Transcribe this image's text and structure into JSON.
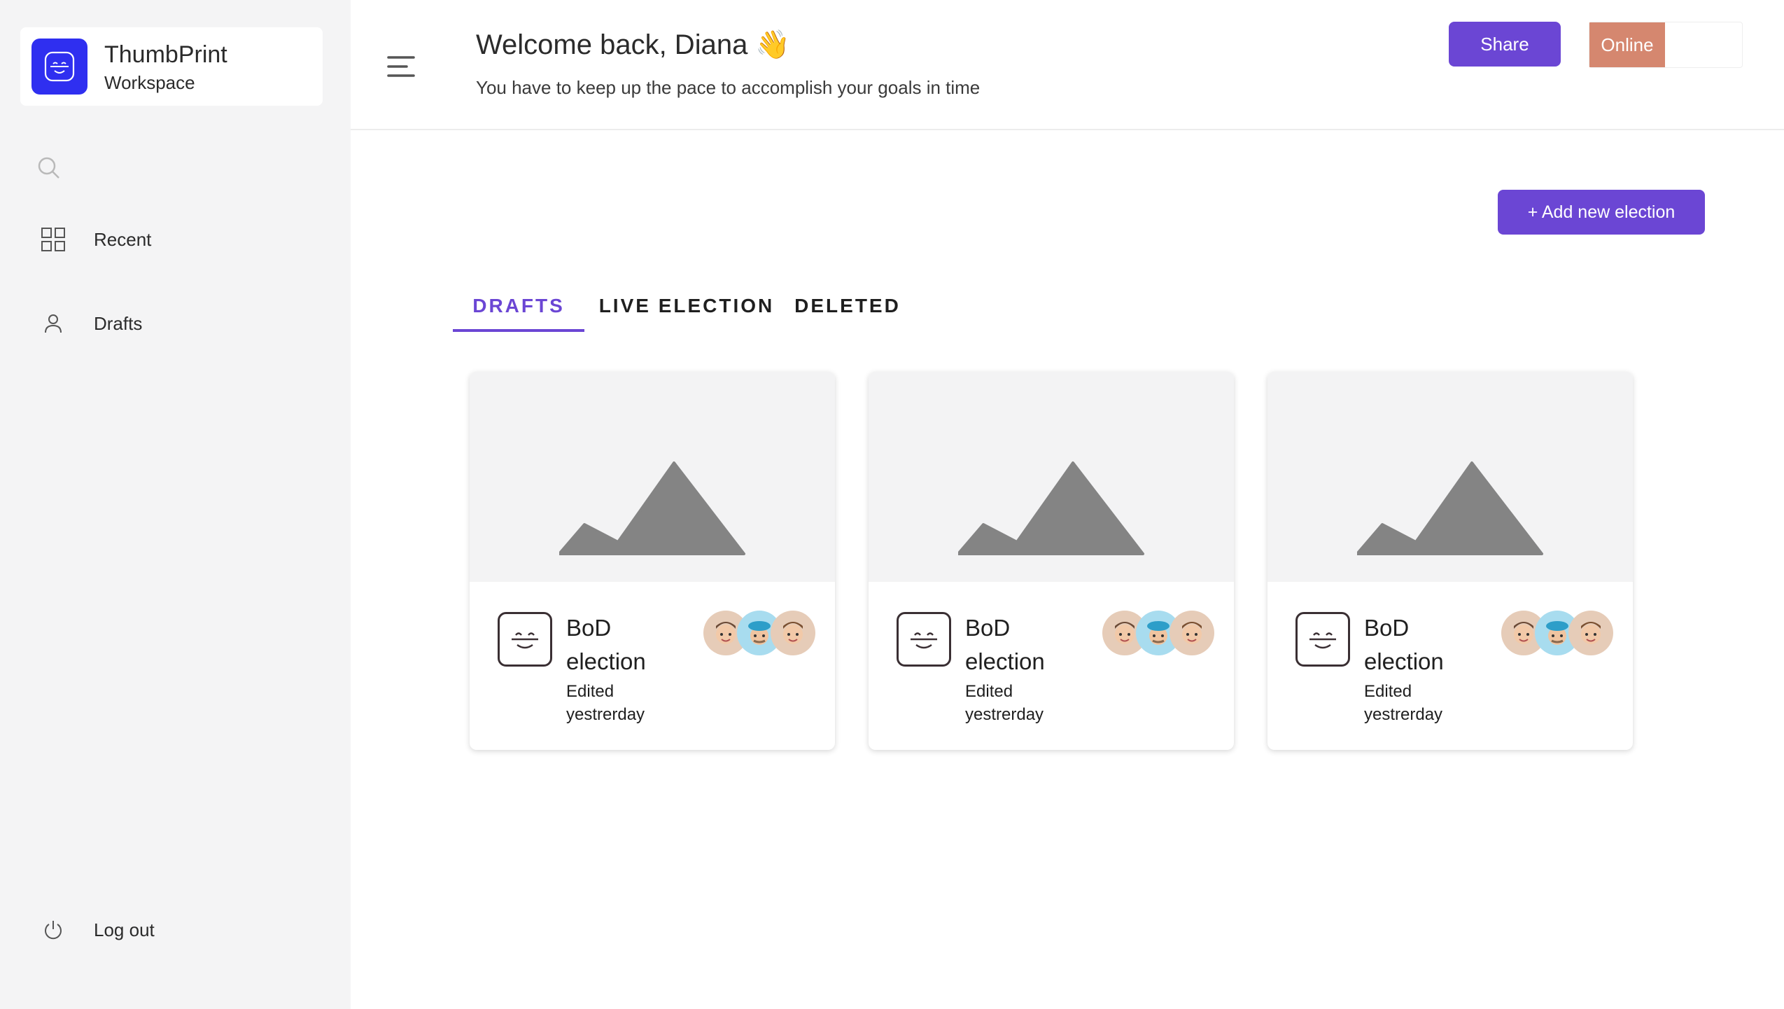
{
  "brand": {
    "name": "ThumbPrint",
    "subtitle": "Workspace",
    "icon": "face-scan-icon",
    "color": "#2f2ff0"
  },
  "sidebar": {
    "search_icon": "search-icon",
    "items": [
      {
        "label": "Recent",
        "icon": "grid-icon"
      },
      {
        "label": "Drafts",
        "icon": "user-icon"
      }
    ],
    "logout": {
      "label": "Log out",
      "icon": "power-icon"
    }
  },
  "header": {
    "menu_icon": "menu-icon",
    "welcome": "Welcome back, Diana 👋",
    "subtitle": "You have to keep up the pace to accomplish your goals in time",
    "share_label": "Share",
    "status_label": "Online"
  },
  "main": {
    "add_button": "+ Add new election",
    "tabs": [
      {
        "label": "DRAFTS",
        "active": true
      },
      {
        "label": "LIVE ELECTION",
        "active": false
      },
      {
        "label": "DELETED",
        "active": false
      }
    ],
    "cards": [
      {
        "title": "BoD election",
        "meta": "Edited yestrerday"
      },
      {
        "title": "BoD election",
        "meta": "Edited yestrerday"
      },
      {
        "title": "BoD election",
        "meta": "Edited yestrerday"
      }
    ]
  },
  "colors": {
    "accent": "#6b46d4",
    "status": "#d5876f",
    "sidebar_bg": "#f4f4f5"
  }
}
